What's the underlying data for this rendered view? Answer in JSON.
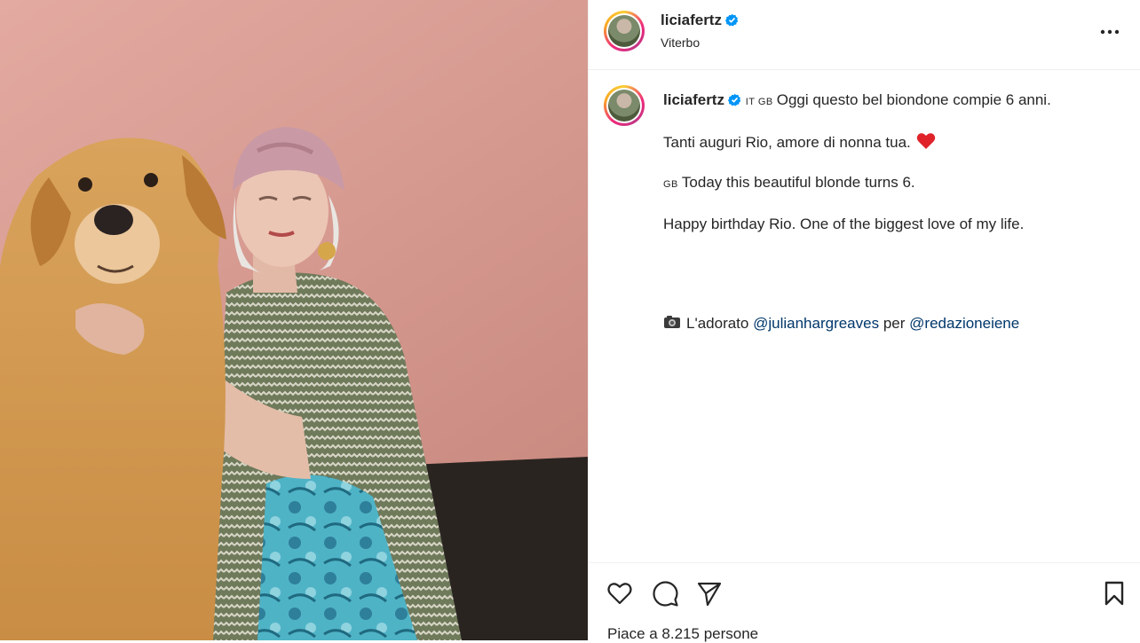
{
  "post": {
    "username": "liciafertz",
    "location": "Viterbo",
    "caption": {
      "line1_flags": "IT GB",
      "line1_text": "Oggi questo bel biondone compie 6 anni.",
      "line2_text": "Tanti auguri Rio, amore di nonna tua.",
      "line3_flag": "GB",
      "line3_text": "Today this beautiful blonde turns 6.",
      "line4_text": "Happy birthday Rio. One of the biggest love of my life.",
      "credit_prefix": "L'adorato",
      "credit_mention1": "@julianhargreaves",
      "credit_middle": "per",
      "credit_mention2": "@redazioneiene"
    },
    "likes_text": "Piace a 8.215 persone"
  },
  "icons": {
    "verified": "verified-badge-icon",
    "more": "more-options-icon",
    "like": "heart-icon",
    "comment": "comment-icon",
    "share": "send-icon",
    "save": "bookmark-icon",
    "heart_emoji": "red-heart-emoji-icon",
    "camera_emoji": "camera-emoji-icon"
  },
  "colors": {
    "verified_blue": "#0095f6",
    "mention_blue": "#00376b",
    "heart_red": "#e0232b",
    "background_pink": "#d79b92"
  }
}
